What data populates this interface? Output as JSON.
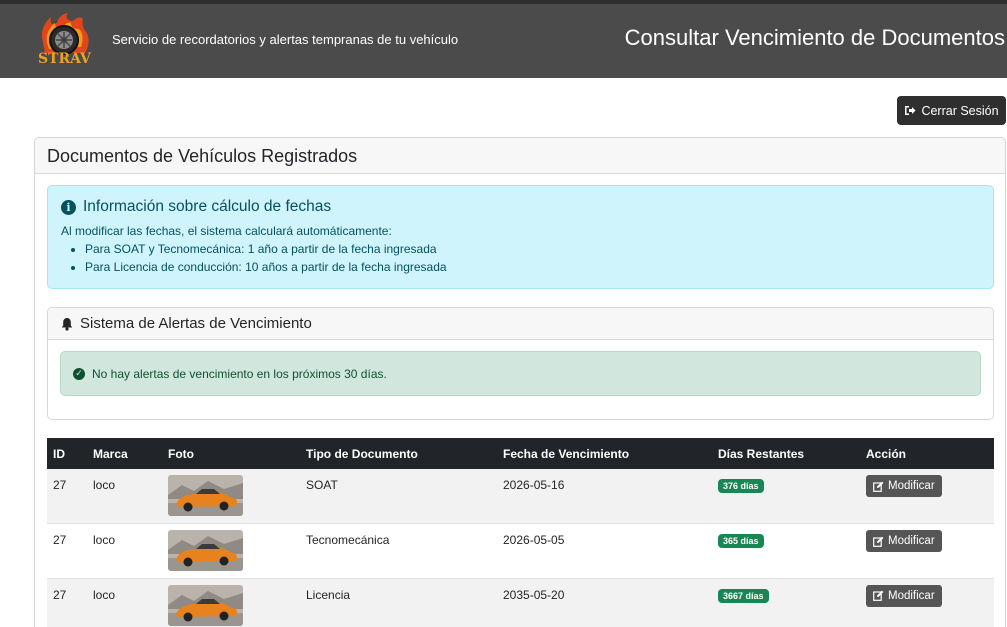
{
  "header": {
    "logo_text": "STRAV",
    "tagline": "Servicio de recordatorios y alertas tempranas de tu vehículo",
    "title": "Consultar Vencimiento de Documentos"
  },
  "logout_label": "Cerrar Sesión",
  "card": {
    "title": "Documentos de Vehículos Registrados"
  },
  "info": {
    "title": "Información sobre cálculo de fechas",
    "text": "Al modificar las fechas, el sistema calculará automáticamente:",
    "items": [
      "Para SOAT y Tecnomecánica: 1 año a partir de la fecha ingresada",
      "Para Licencia de conducción: 10 años a partir de la fecha ingresada"
    ]
  },
  "alerts": {
    "title": "Sistema de Alertas de Vencimiento",
    "message": "No hay alertas de vencimiento en los próximos 30 días."
  },
  "table": {
    "columns": [
      "ID",
      "Marca",
      "Foto",
      "Tipo de Documento",
      "Fecha de Vencimiento",
      "Días Restantes",
      "Acción"
    ],
    "rows": [
      {
        "id": "27",
        "marca": "loco",
        "tipo": "SOAT",
        "fecha": "2026-05-16",
        "dias": "376 días",
        "accion": "Modificar"
      },
      {
        "id": "27",
        "marca": "loco",
        "tipo": "Tecnomecánica",
        "fecha": "2026-05-05",
        "dias": "365 días",
        "accion": "Modificar"
      },
      {
        "id": "27",
        "marca": "loco",
        "tipo": "Licencia",
        "fecha": "2035-05-20",
        "dias": "3667 días",
        "accion": "Modificar"
      }
    ]
  },
  "colors": {
    "topbar": "#4b4b4b",
    "info_bg": "#cff4fc",
    "success_bg": "#d1e7dd",
    "badge": "#198754",
    "table_head": "#212529"
  }
}
